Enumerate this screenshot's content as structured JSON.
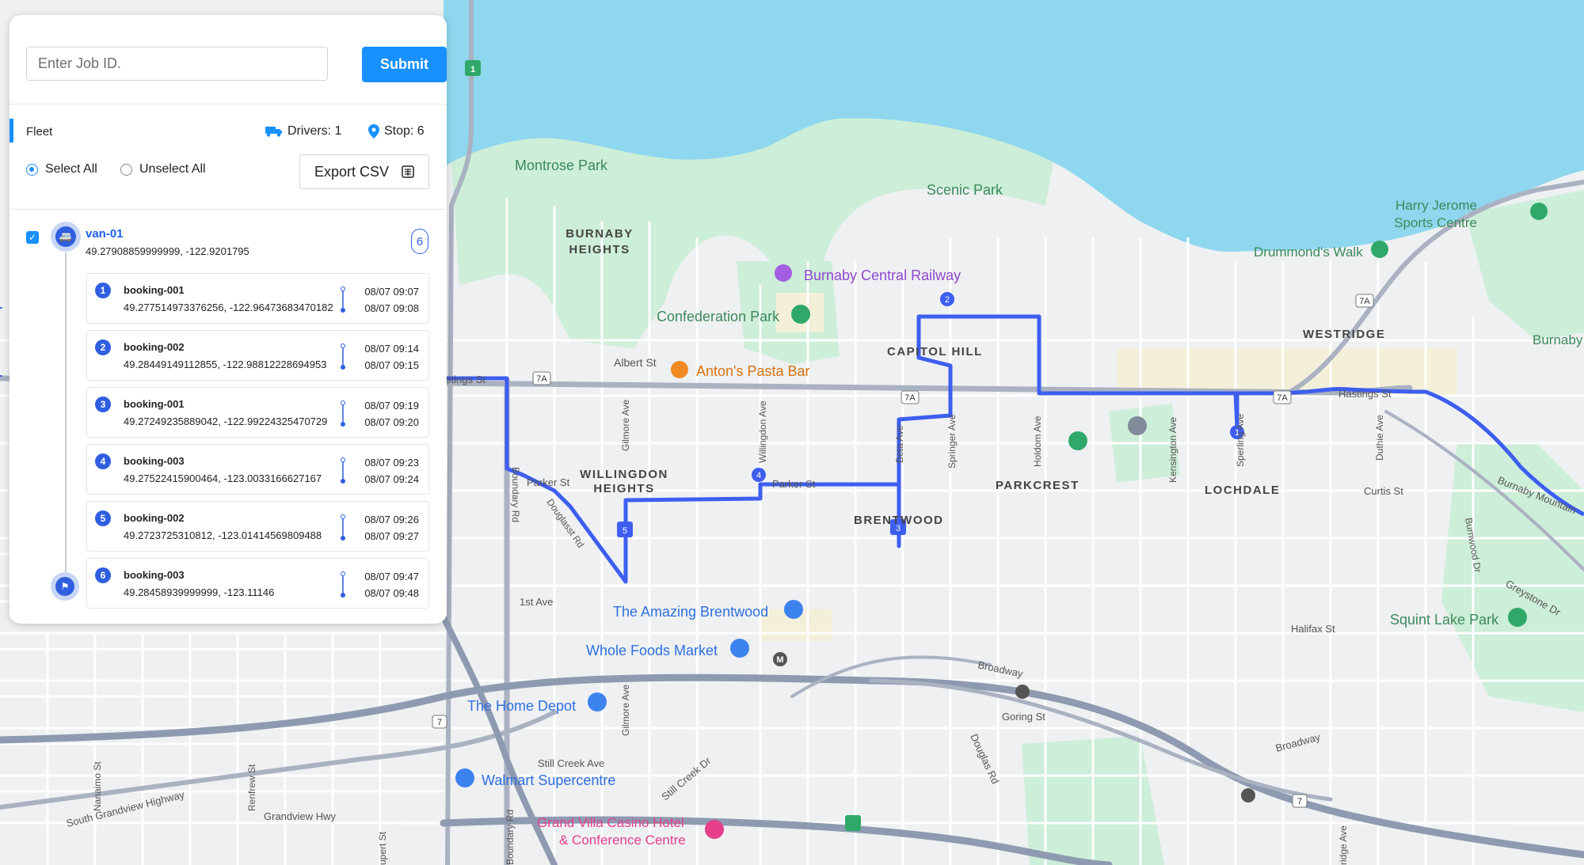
{
  "search": {
    "placeholder": "Enter Job ID.",
    "submit_label": "Submit"
  },
  "fleet": {
    "tab_label": "Fleet",
    "drivers_label": "Drivers: 1",
    "stops_label": "Stop: 6",
    "select_all_label": "Select All",
    "unselect_all_label": "Unselect All",
    "export_label": "Export CSV"
  },
  "vehicle": {
    "name": "van-01",
    "coords": "49.27908859999999, -122.9201795",
    "stop_count": "6",
    "checked": true
  },
  "stops": [
    {
      "num": "1",
      "name": "booking-001",
      "coords": "49.277514973376256, -122.96473683470182",
      "start": "08/07 09:07",
      "end": "08/07 09:08"
    },
    {
      "num": "2",
      "name": "booking-002",
      "coords": "49.28449149112855, -122.98812228694953",
      "start": "08/07 09:14",
      "end": "08/07 09:15"
    },
    {
      "num": "3",
      "name": "booking-001",
      "coords": "49.27249235889042, -122.99224325470729",
      "start": "08/07 09:19",
      "end": "08/07 09:20"
    },
    {
      "num": "4",
      "name": "booking-003",
      "coords": "49.27522415900464, -123.0033166627167",
      "start": "08/07 09:23",
      "end": "08/07 09:24"
    },
    {
      "num": "5",
      "name": "booking-002",
      "coords": "49.2723725310812, -123.01414569809488",
      "start": "08/07 09:26",
      "end": "08/07 09:27"
    },
    {
      "num": "6",
      "name": "booking-003",
      "coords": "49.28458939999999, -123.11146",
      "start": "08/07 09:47",
      "end": "08/07 09:48"
    }
  ],
  "map": {
    "route_color": "#3d5ef0",
    "water_color": "#8fd7ee",
    "park_color": "#cdeed8",
    "labels": {
      "montrose_park": "Montrose Park",
      "scenic_park": "Scenic Park",
      "burnaby_heights_1": "BURNABY",
      "burnaby_heights_2": "HEIGHTS",
      "burnaby_central_railway": "Burnaby Central Railway",
      "confederation_park": "Confederation Park",
      "capitol_hill": "CAPITOL HILL",
      "albert_st": "Albert St",
      "antons_pasta_bar": "Anton's Pasta Bar",
      "westridge": "WESTRIDGE",
      "harry_jerome_1": "Harry Jerome",
      "harry_jerome_2": "Sports Centre",
      "drummonds_walk": "Drummond's Walk",
      "burnaby_edge": "Burnaby",
      "hastings_st_left": "stings St",
      "hastings_st_right": "Hastings St",
      "willingdon_heights_1": "WILLINGDON",
      "willingdon_heights_2": "HEIGHTS",
      "parker_st_1": "Parker St",
      "parker_st_2": "Parker St",
      "brentwood": "BRENTWOOD",
      "parkcrest": "PARKCREST",
      "lochdale": "LOCHDALE",
      "curtis_st": "Curtis St",
      "burnaby_mountain": "Burnaby Mountain",
      "first_ave": "1st Ave",
      "amazing_brentwood": "The Amazing Brentwood",
      "whole_foods": "Whole Foods Market",
      "home_depot": "The Home Depot",
      "walmart": "Walmart Supercentre",
      "grand_villa_1": "Grand Villa Casino Hotel",
      "grand_villa_2": "& Conference Centre",
      "squint_lake_park": "Squint Lake Park",
      "halifax_st": "Halifax St",
      "greystone_dr": "Greystone Dr",
      "broadway_1": "Broadway",
      "broadway_2": "Broadway",
      "goring_st": "Goring St",
      "douglas_rd": "Douglas Rd",
      "still_creek_ave": "Still Creek Ave",
      "still_creek_dr": "Still Creek Dr",
      "grandview_hwy": "Grandview Hwy",
      "south_grandview_hwy": "South Grandview Highway",
      "nanaimo_st": "Nanaimo St",
      "renfrew_st": "Renfrew St",
      "rupert_st": "upert St",
      "boundary_rd_top": "Boundary Rd",
      "boundary_rd_bottom": "Boundary Rd",
      "gilmore_ave_1": "Gilmore Ave",
      "gilmore_ave_2": "Gilmore Ave",
      "willingdon_ave": "Willingdon Ave",
      "beta_ave": "Beta Ave",
      "springer_ave": "Springer Ave",
      "holdom_ave": "Holdom Ave",
      "kensington_ave": "Kensington Ave",
      "sperling_ave": "Sperling Ave",
      "duthie_ave": "Duthie Ave",
      "burnwood_dr": "Burnwood Dr",
      "douglas_st": "Douglasst Rd",
      "hwy_7a_1": "7A",
      "hwy_7a_2": "7A",
      "hwy_7a_3": "7A",
      "hwy_7a_4": "7A",
      "hwy_7_1": "7",
      "hwy_7_2": "7",
      "hwy_1": "1",
      "metro_m": "M",
      "ridge_ave": "ridge Ave"
    },
    "route_markers": [
      "1",
      "2",
      "3",
      "4",
      "5"
    ]
  }
}
